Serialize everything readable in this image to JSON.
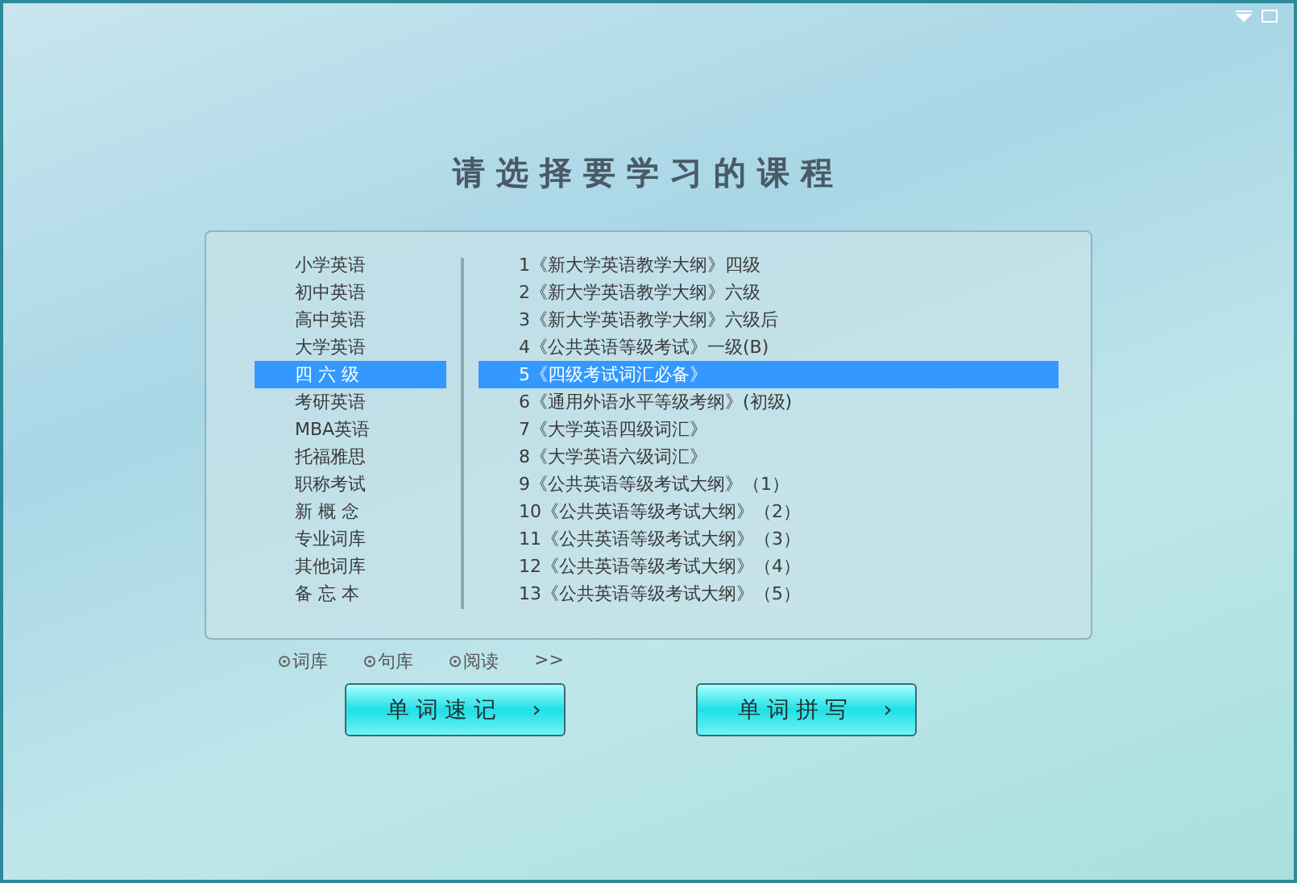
{
  "title": "请选择要学习的课程",
  "categories": [
    {
      "label": "小学英语",
      "selected": false
    },
    {
      "label": "初中英语",
      "selected": false
    },
    {
      "label": "高中英语",
      "selected": false
    },
    {
      "label": "大学英语",
      "selected": false
    },
    {
      "label": "四 六 级",
      "selected": true
    },
    {
      "label": "考研英语",
      "selected": false
    },
    {
      "label": "MBA英语",
      "selected": false
    },
    {
      "label": "托福雅思",
      "selected": false
    },
    {
      "label": "职称考试",
      "selected": false
    },
    {
      "label": "新 概 念",
      "selected": false
    },
    {
      "label": "专业词库",
      "selected": false
    },
    {
      "label": "其他词库",
      "selected": false
    },
    {
      "label": "备 忘 本",
      "selected": false
    }
  ],
  "courses": [
    {
      "label": "1《新大学英语教学大纲》四级",
      "selected": false
    },
    {
      "label": "2《新大学英语教学大纲》六级",
      "selected": false
    },
    {
      "label": "3《新大学英语教学大纲》六级后",
      "selected": false
    },
    {
      "label": "4《公共英语等级考试》一级(B)",
      "selected": false
    },
    {
      "label": "5《四级考试词汇必备》",
      "selected": true
    },
    {
      "label": "6《通用外语水平等级考纲》(初级)",
      "selected": false
    },
    {
      "label": "7《大学英语四级词汇》",
      "selected": false
    },
    {
      "label": "8《大学英语六级词汇》",
      "selected": false
    },
    {
      "label": "9《公共英语等级考试大纲》（1）",
      "selected": false
    },
    {
      "label": "10《公共英语等级考试大纲》（2）",
      "selected": false
    },
    {
      "label": "11《公共英语等级考试大纲》（3）",
      "selected": false
    },
    {
      "label": "12《公共英语等级考试大纲》（4）",
      "selected": false
    },
    {
      "label": "13《公共英语等级考试大纲》（5）",
      "selected": false
    }
  ],
  "links": [
    {
      "label": "词库"
    },
    {
      "label": "句库"
    },
    {
      "label": "阅读"
    }
  ],
  "more": ">>",
  "buttons": [
    {
      "label": "单词速记",
      "arrow": "›"
    },
    {
      "label": "单词拼写",
      "arrow": "›"
    }
  ]
}
